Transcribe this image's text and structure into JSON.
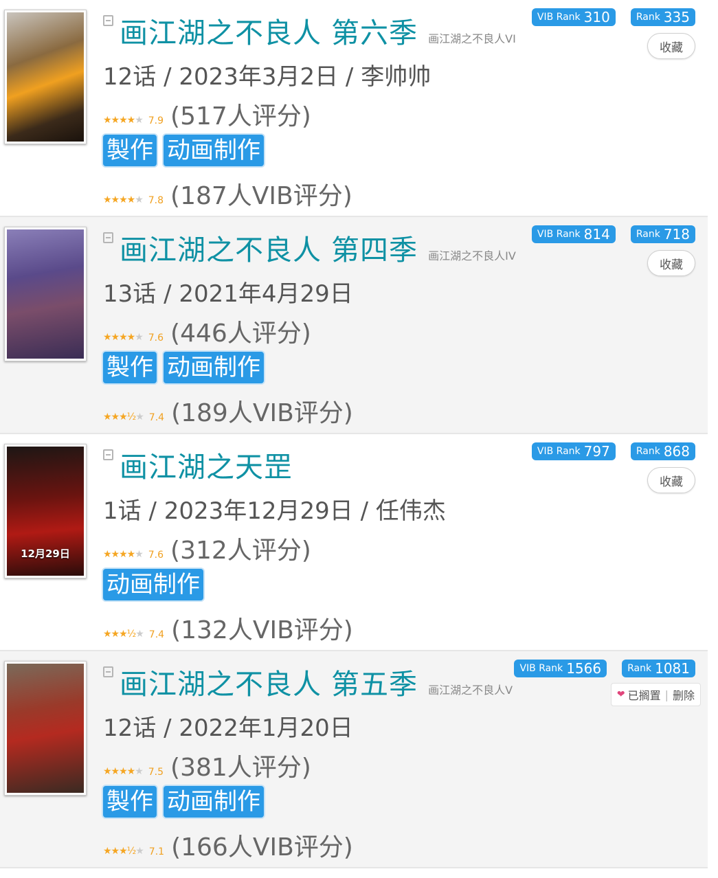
{
  "colors": {
    "title": "#0f91a4",
    "tag": "#2a9ae6",
    "star_on": "#f5a623",
    "score": "#f0a020"
  },
  "items": [
    {
      "title": "画江湖之不良人 第六季",
      "subtitle": "画江湖之不良人VI",
      "info": "12话 / 2023年3月2日 / 李帅帅",
      "rating": {
        "stars": "★★★★",
        "stars_off": "★",
        "score": "7.9",
        "count": "(517人评分)"
      },
      "tags": [
        "製作",
        "动画制作"
      ],
      "vib_rating": {
        "stars": "★★★★",
        "stars_off": "★",
        "score": "7.8",
        "count": "(187人VIB评分)"
      },
      "vib_rank_label": "VIB Rank",
      "vib_rank": "310",
      "rank_label": "Rank",
      "rank": "335",
      "action": "收藏"
    },
    {
      "title": "画江湖之不良人 第四季",
      "subtitle": "画江湖之不良人IV",
      "info": "13话 / 2021年4月29日",
      "rating": {
        "stars": "★★★★",
        "stars_off": "★",
        "score": "7.6",
        "count": "(446人评分)"
      },
      "tags": [
        "製作",
        "动画制作"
      ],
      "vib_rating": {
        "stars": "★★★½",
        "stars_off": "★",
        "score": "7.4",
        "count": "(189人VIB评分)"
      },
      "vib_rank_label": "VIB Rank",
      "vib_rank": "814",
      "rank_label": "Rank",
      "rank": "718",
      "action": "收藏"
    },
    {
      "title": "画江湖之天罡",
      "subtitle": "",
      "info": "1话 / 2023年12月29日 / 任伟杰",
      "rating": {
        "stars": "★★★★",
        "stars_off": "★",
        "score": "7.6",
        "count": "(312人评分)"
      },
      "tags": [
        "动画制作"
      ],
      "vib_rating": {
        "stars": "★★★½",
        "stars_off": "★",
        "score": "7.4",
        "count": "(132人VIB评分)"
      },
      "vib_rank_label": "VIB Rank",
      "vib_rank": "797",
      "rank_label": "Rank",
      "rank": "868",
      "action": "收藏",
      "poster_caption": "12月29日"
    },
    {
      "title": "画江湖之不良人 第五季",
      "subtitle": "画江湖之不良人V",
      "info": "12话 / 2022年1月20日",
      "rating": {
        "stars": "★★★★",
        "stars_off": "★",
        "score": "7.5",
        "count": "(381人评分)"
      },
      "tags": [
        "製作",
        "动画制作"
      ],
      "vib_rating": {
        "stars": "★★★½",
        "stars_off": "★",
        "score": "7.1",
        "count": "(166人VIB评分)"
      },
      "vib_rank_label": "VIB Rank",
      "vib_rank": "1566",
      "rank_label": "Rank",
      "rank": "1081",
      "shelved_label": "已搁置",
      "delete_label": "删除"
    }
  ]
}
